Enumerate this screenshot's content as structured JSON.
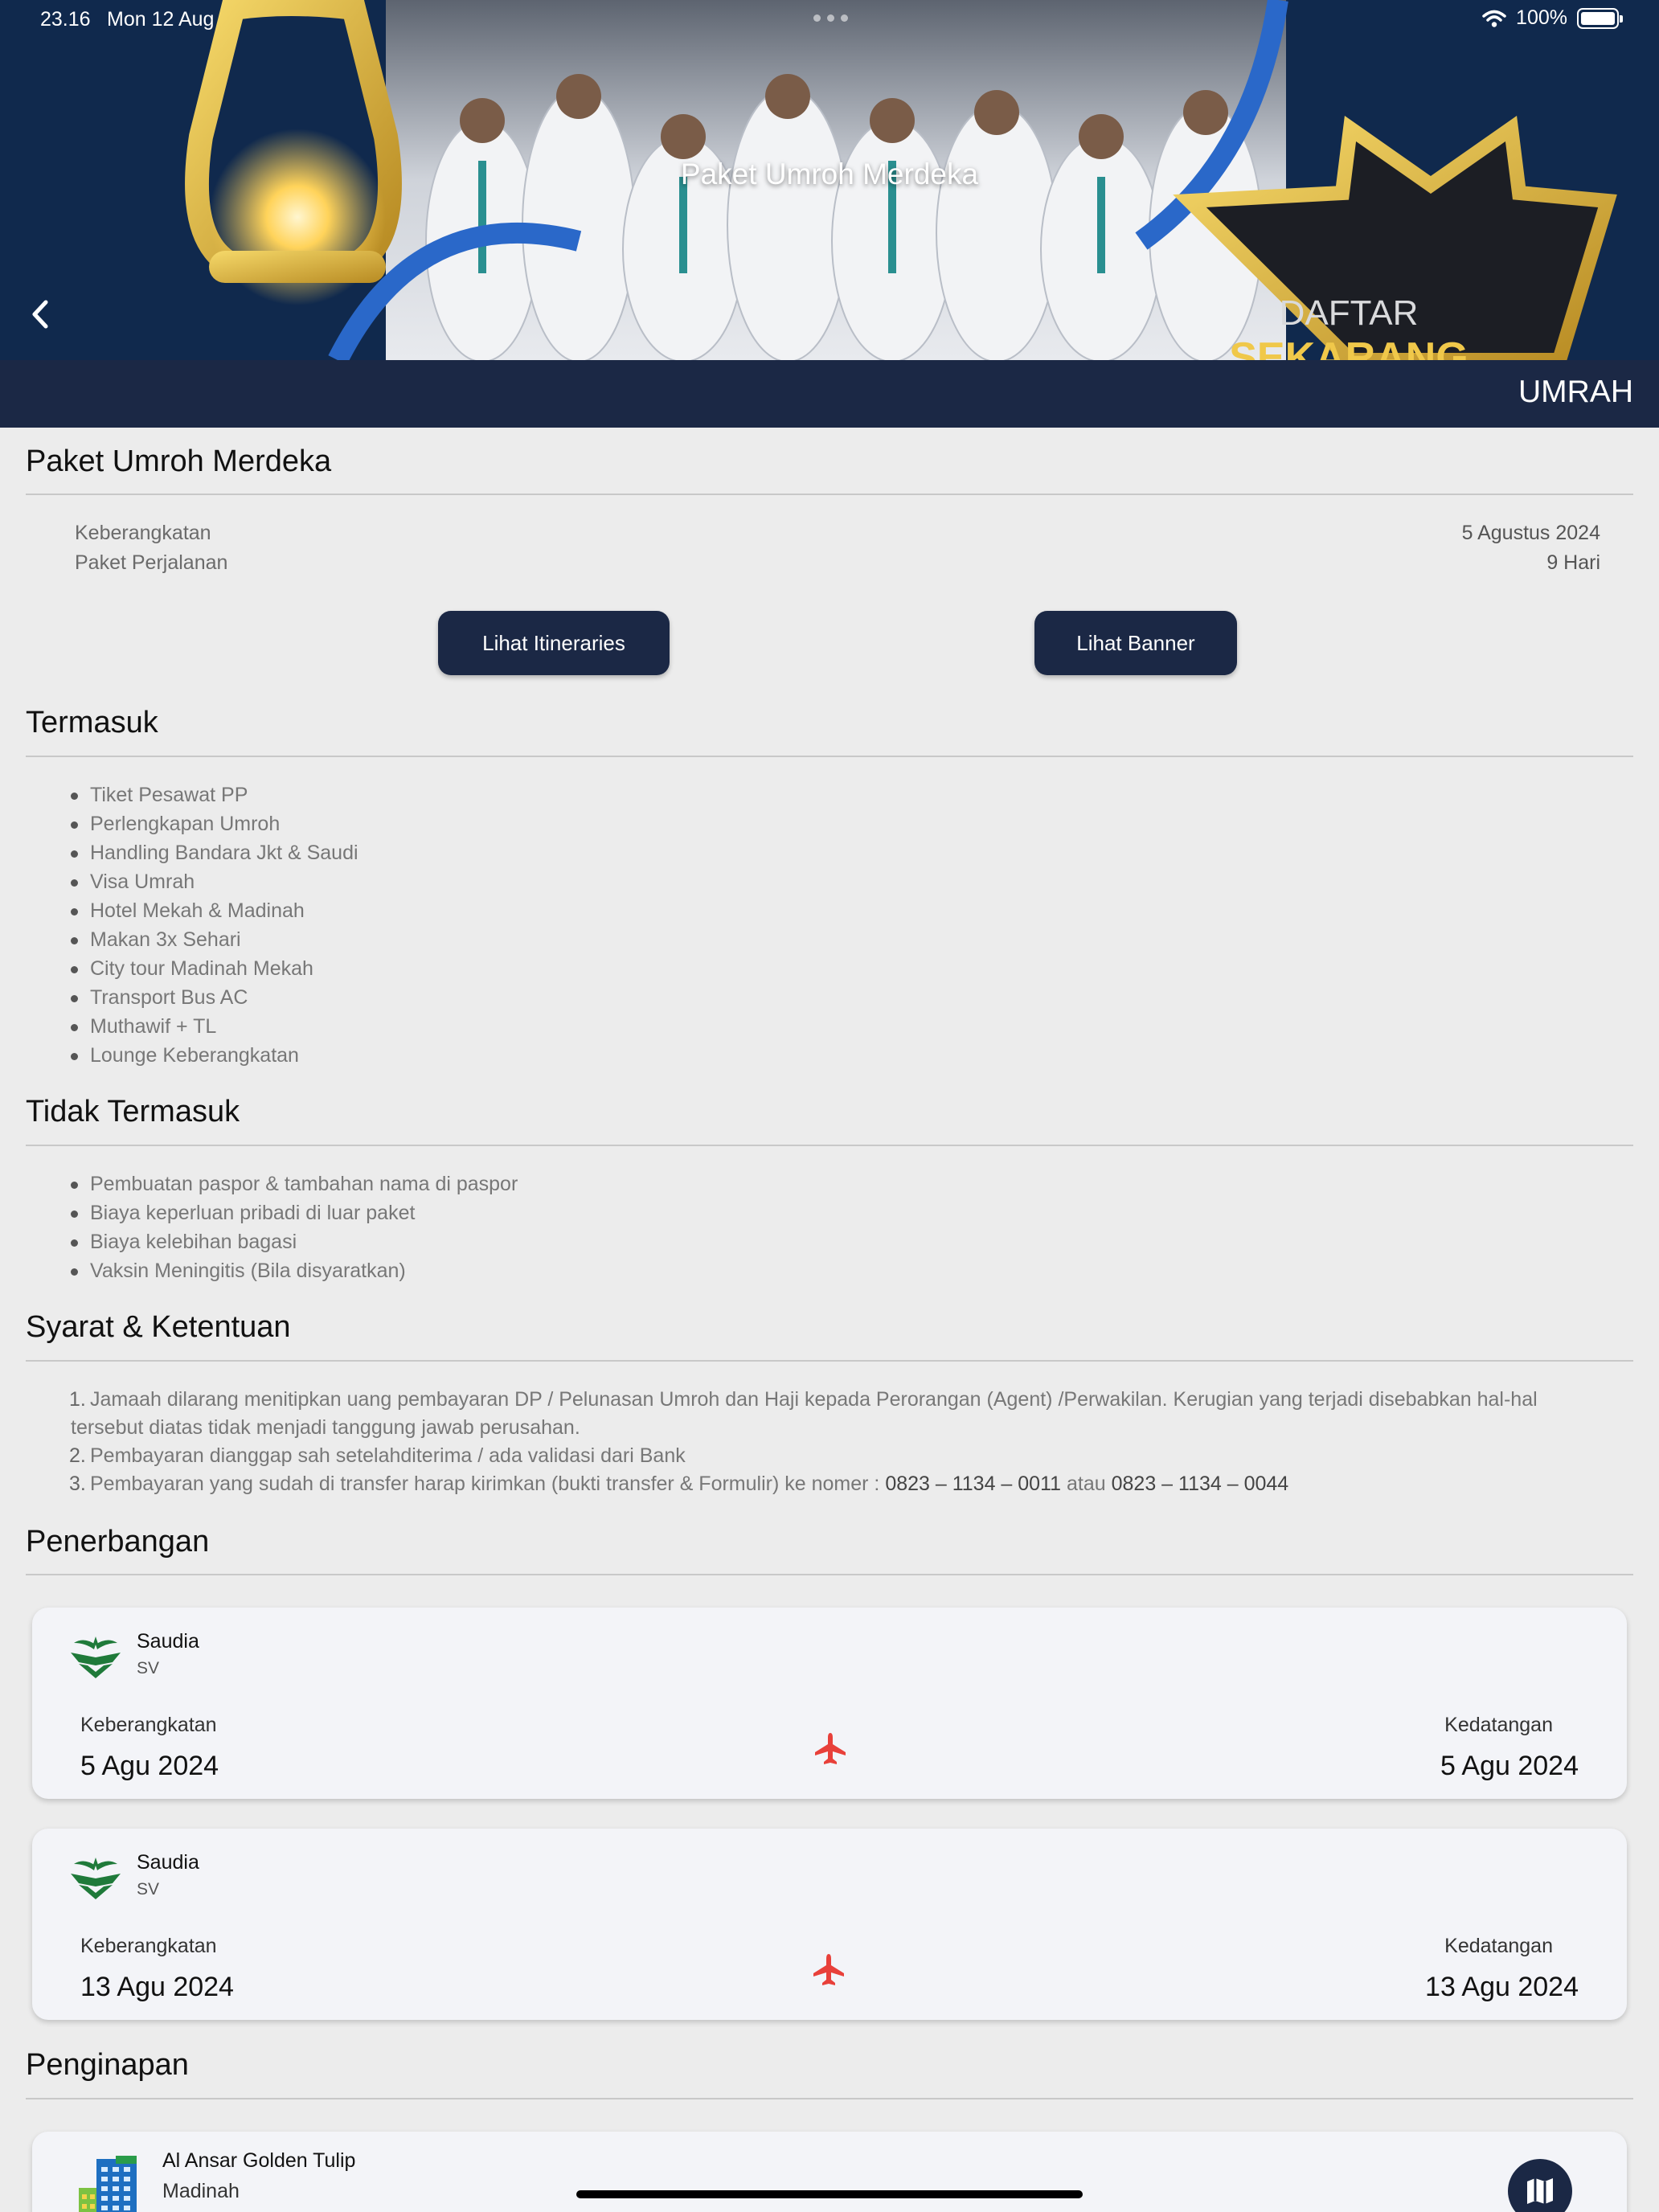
{
  "status_bar": {
    "time": "23.16",
    "date": "Mon 12 Aug",
    "battery": "100%",
    "battery_level": 1.0
  },
  "banner": {
    "title": "Paket Umroh Merdeka",
    "image_text_line1": "DAFTAR",
    "image_text_line2": "SEKARANG"
  },
  "category": "UMRAH",
  "package": {
    "title": "Paket Umroh Merdeka",
    "departure_label": "Keberangkatan",
    "departure_value": "5 Agustus 2024",
    "duration_label": "Paket Perjalanan",
    "duration_value": "9 Hari",
    "itinerary_button": "Lihat Itineraries",
    "banner_button": "Lihat Banner"
  },
  "included": {
    "title": "Termasuk",
    "items": [
      "Tiket Pesawat PP",
      "Perlengkapan Umroh",
      "Handling Bandara Jkt & Saudi",
      "Visa Umrah",
      "Hotel Mekah & Madinah",
      "Makan 3x Sehari",
      "City tour Madinah Mekah",
      "Transport Bus AC",
      "Muthawif + TL",
      "Lounge Keberangkatan"
    ]
  },
  "excluded": {
    "title": "Tidak Termasuk",
    "items": [
      "Pembuatan paspor & tambahan nama di paspor",
      "Biaya keperluan pribadi di luar paket",
      "Biaya kelebihan bagasi",
      "Vaksin Meningitis (Bila disyaratkan)"
    ]
  },
  "terms": {
    "title": "Syarat & Ketentuan",
    "item1_line1": "Jamaah dilarang menitipkan uang pembayaran DP / Pelunasan Umroh dan Haji kepada Perorangan (Agent) /Perwakilan. Kerugian yang terjadi disebabkan hal-hal",
    "item1_line2": "tersebut diatas tidak menjadi tanggung jawab perusahan.",
    "item2": "Pembayaran dianggap sah setelahditerima / ada validasi dari Bank",
    "item3_prefix": "Pembayaran yang sudah di transfer harap kirimkan (bukti transfer & Formulir) ke nomer :",
    "phone1": "0823 – 1134 – 0011",
    "item3_or": "atau",
    "phone2": "0823 – 1134 – 0044"
  },
  "flights": {
    "title": "Penerbangan",
    "list": [
      {
        "airline": "Saudia",
        "code": "SV",
        "departure_label": "Keberangkatan",
        "departure_date": "5 Agu 2024",
        "arrival_label": "Kedatangan",
        "arrival_date": "5 Agu 2024"
      },
      {
        "airline": "Saudia",
        "code": "SV",
        "departure_label": "Keberangkatan",
        "departure_date": "13 Agu 2024",
        "arrival_label": "Kedatangan",
        "arrival_date": "13 Agu 2024"
      }
    ]
  },
  "lodging": {
    "title": "Penginapan",
    "hotel_name": "Al Ansar Golden Tulip",
    "hotel_city": "Madinah"
  },
  "icons": {
    "back": "chevron-left-icon",
    "plane": "plane-icon",
    "map": "map-icon",
    "hotel": "hotel-building-icon",
    "airline": "saudia-logo-icon",
    "wifi": "wifi-icon",
    "battery": "battery-icon"
  },
  "colors": {
    "navy": "#1b2845",
    "plane_red": "#e8403a",
    "saudia_green": "#1f7a3a",
    "background": "#ececec",
    "card": "#f3f4f8"
  }
}
